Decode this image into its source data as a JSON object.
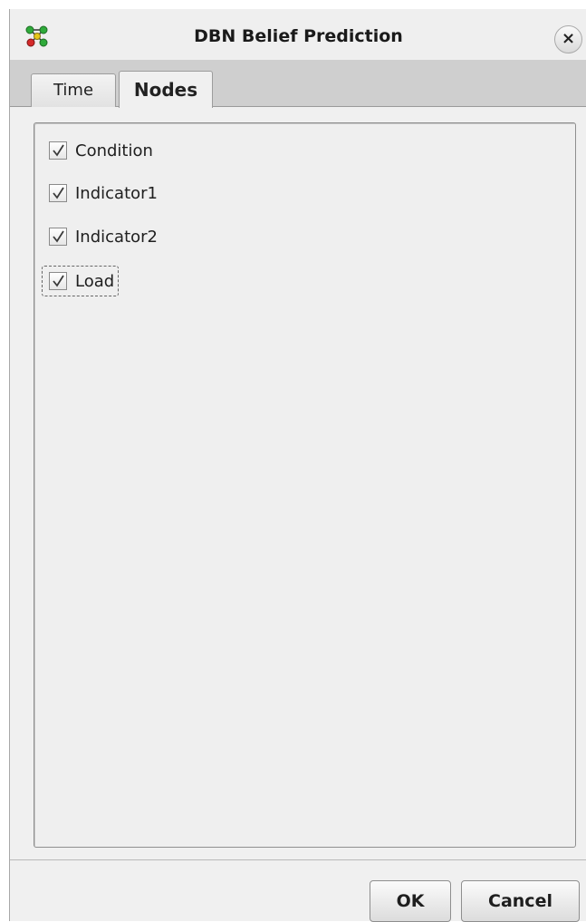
{
  "window": {
    "title": "DBN Belief Prediction",
    "icon": "network-graph-icon",
    "close_symbol": "×"
  },
  "tabs": [
    {
      "label": "Time",
      "selected": false
    },
    {
      "label": "Nodes",
      "selected": true
    }
  ],
  "nodes": [
    {
      "label": "Condition",
      "checked": true
    },
    {
      "label": "Indicator1",
      "checked": true
    },
    {
      "label": "Indicator2",
      "checked": true
    },
    {
      "label": "Load",
      "checked": true,
      "focused": true
    }
  ],
  "buttons": {
    "ok_label": "OK",
    "cancel_label": "Cancel"
  },
  "colors": {
    "node_green": "#2faa3a",
    "node_red": "#d42a2a",
    "node_yellow": "#e6c619"
  }
}
